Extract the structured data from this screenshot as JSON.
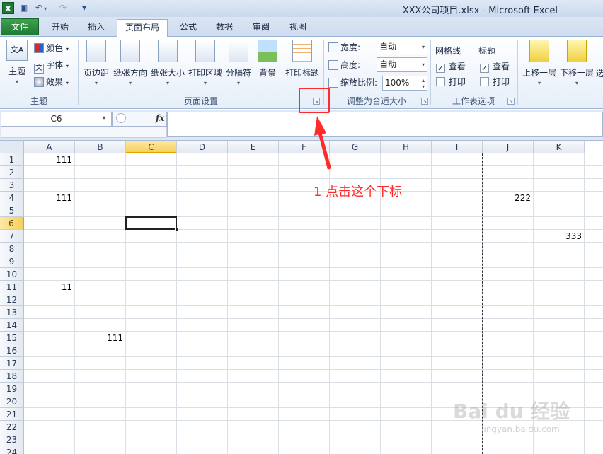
{
  "window": {
    "title": "XXX公司项目.xlsx  -  Microsoft Excel",
    "app_icon": "X"
  },
  "quick_access": [
    "save-icon",
    "undo-icon",
    "redo-icon"
  ],
  "tabs": [
    {
      "label": "文件"
    },
    {
      "label": "开始"
    },
    {
      "label": "插入"
    },
    {
      "label": "页面布局"
    },
    {
      "label": "公式"
    },
    {
      "label": "数据"
    },
    {
      "label": "审阅"
    },
    {
      "label": "视图"
    }
  ],
  "ribbon": {
    "theme_group": {
      "label": "主题",
      "theme_button": "主题",
      "colors": "颜色",
      "fonts": "字体",
      "effects": "效果"
    },
    "page_setup_group": {
      "label": "页面设置",
      "buttons": [
        "页边距",
        "纸张方向",
        "纸张大小",
        "打印区域",
        "分隔符",
        "背景",
        "打印标题"
      ]
    },
    "scale_group": {
      "label": "调整为合适大小",
      "width_label": "宽度:",
      "width_value": "自动",
      "height_label": "高度:",
      "height_value": "自动",
      "scale_label": "缩放比例:",
      "scale_value": "100%"
    },
    "sheet_options_group": {
      "label": "工作表选项",
      "gridlines": "网格线",
      "headings": "标题",
      "view": "查看",
      "print": "打印"
    },
    "arrange_group": {
      "bring_forward": "上移一层",
      "send_backward": "下移一层",
      "partial": "选"
    }
  },
  "formula_bar": {
    "name_box": "C6",
    "fx": "fx",
    "value": ""
  },
  "sheet": {
    "columns": [
      "A",
      "B",
      "C",
      "D",
      "E",
      "F",
      "G",
      "H",
      "I",
      "J",
      "K"
    ],
    "rows": [
      "1",
      "2",
      "3",
      "4",
      "5",
      "6",
      "7",
      "8",
      "9",
      "10",
      "11",
      "12",
      "13",
      "14",
      "15",
      "16",
      "17",
      "18",
      "19",
      "20",
      "21",
      "22",
      "23",
      "24"
    ],
    "selected_col": "C",
    "selected_row": "6",
    "cells": [
      {
        "ref": "A1",
        "value": "111"
      },
      {
        "ref": "A4",
        "value": "111"
      },
      {
        "ref": "J4",
        "value": "222"
      },
      {
        "ref": "K7",
        "value": "333"
      },
      {
        "ref": "A11",
        "value": "11"
      },
      {
        "ref": "B15",
        "value": "111"
      }
    ]
  },
  "annotation": {
    "text": "1 点击这个下标",
    "color": "#ff2a2a"
  },
  "watermark": {
    "text": "Bai du 经验",
    "url": "jingyan.baidu.com"
  },
  "colors": {
    "file_tab": "#1e7a34",
    "selection_header": "#f7cf5c"
  }
}
